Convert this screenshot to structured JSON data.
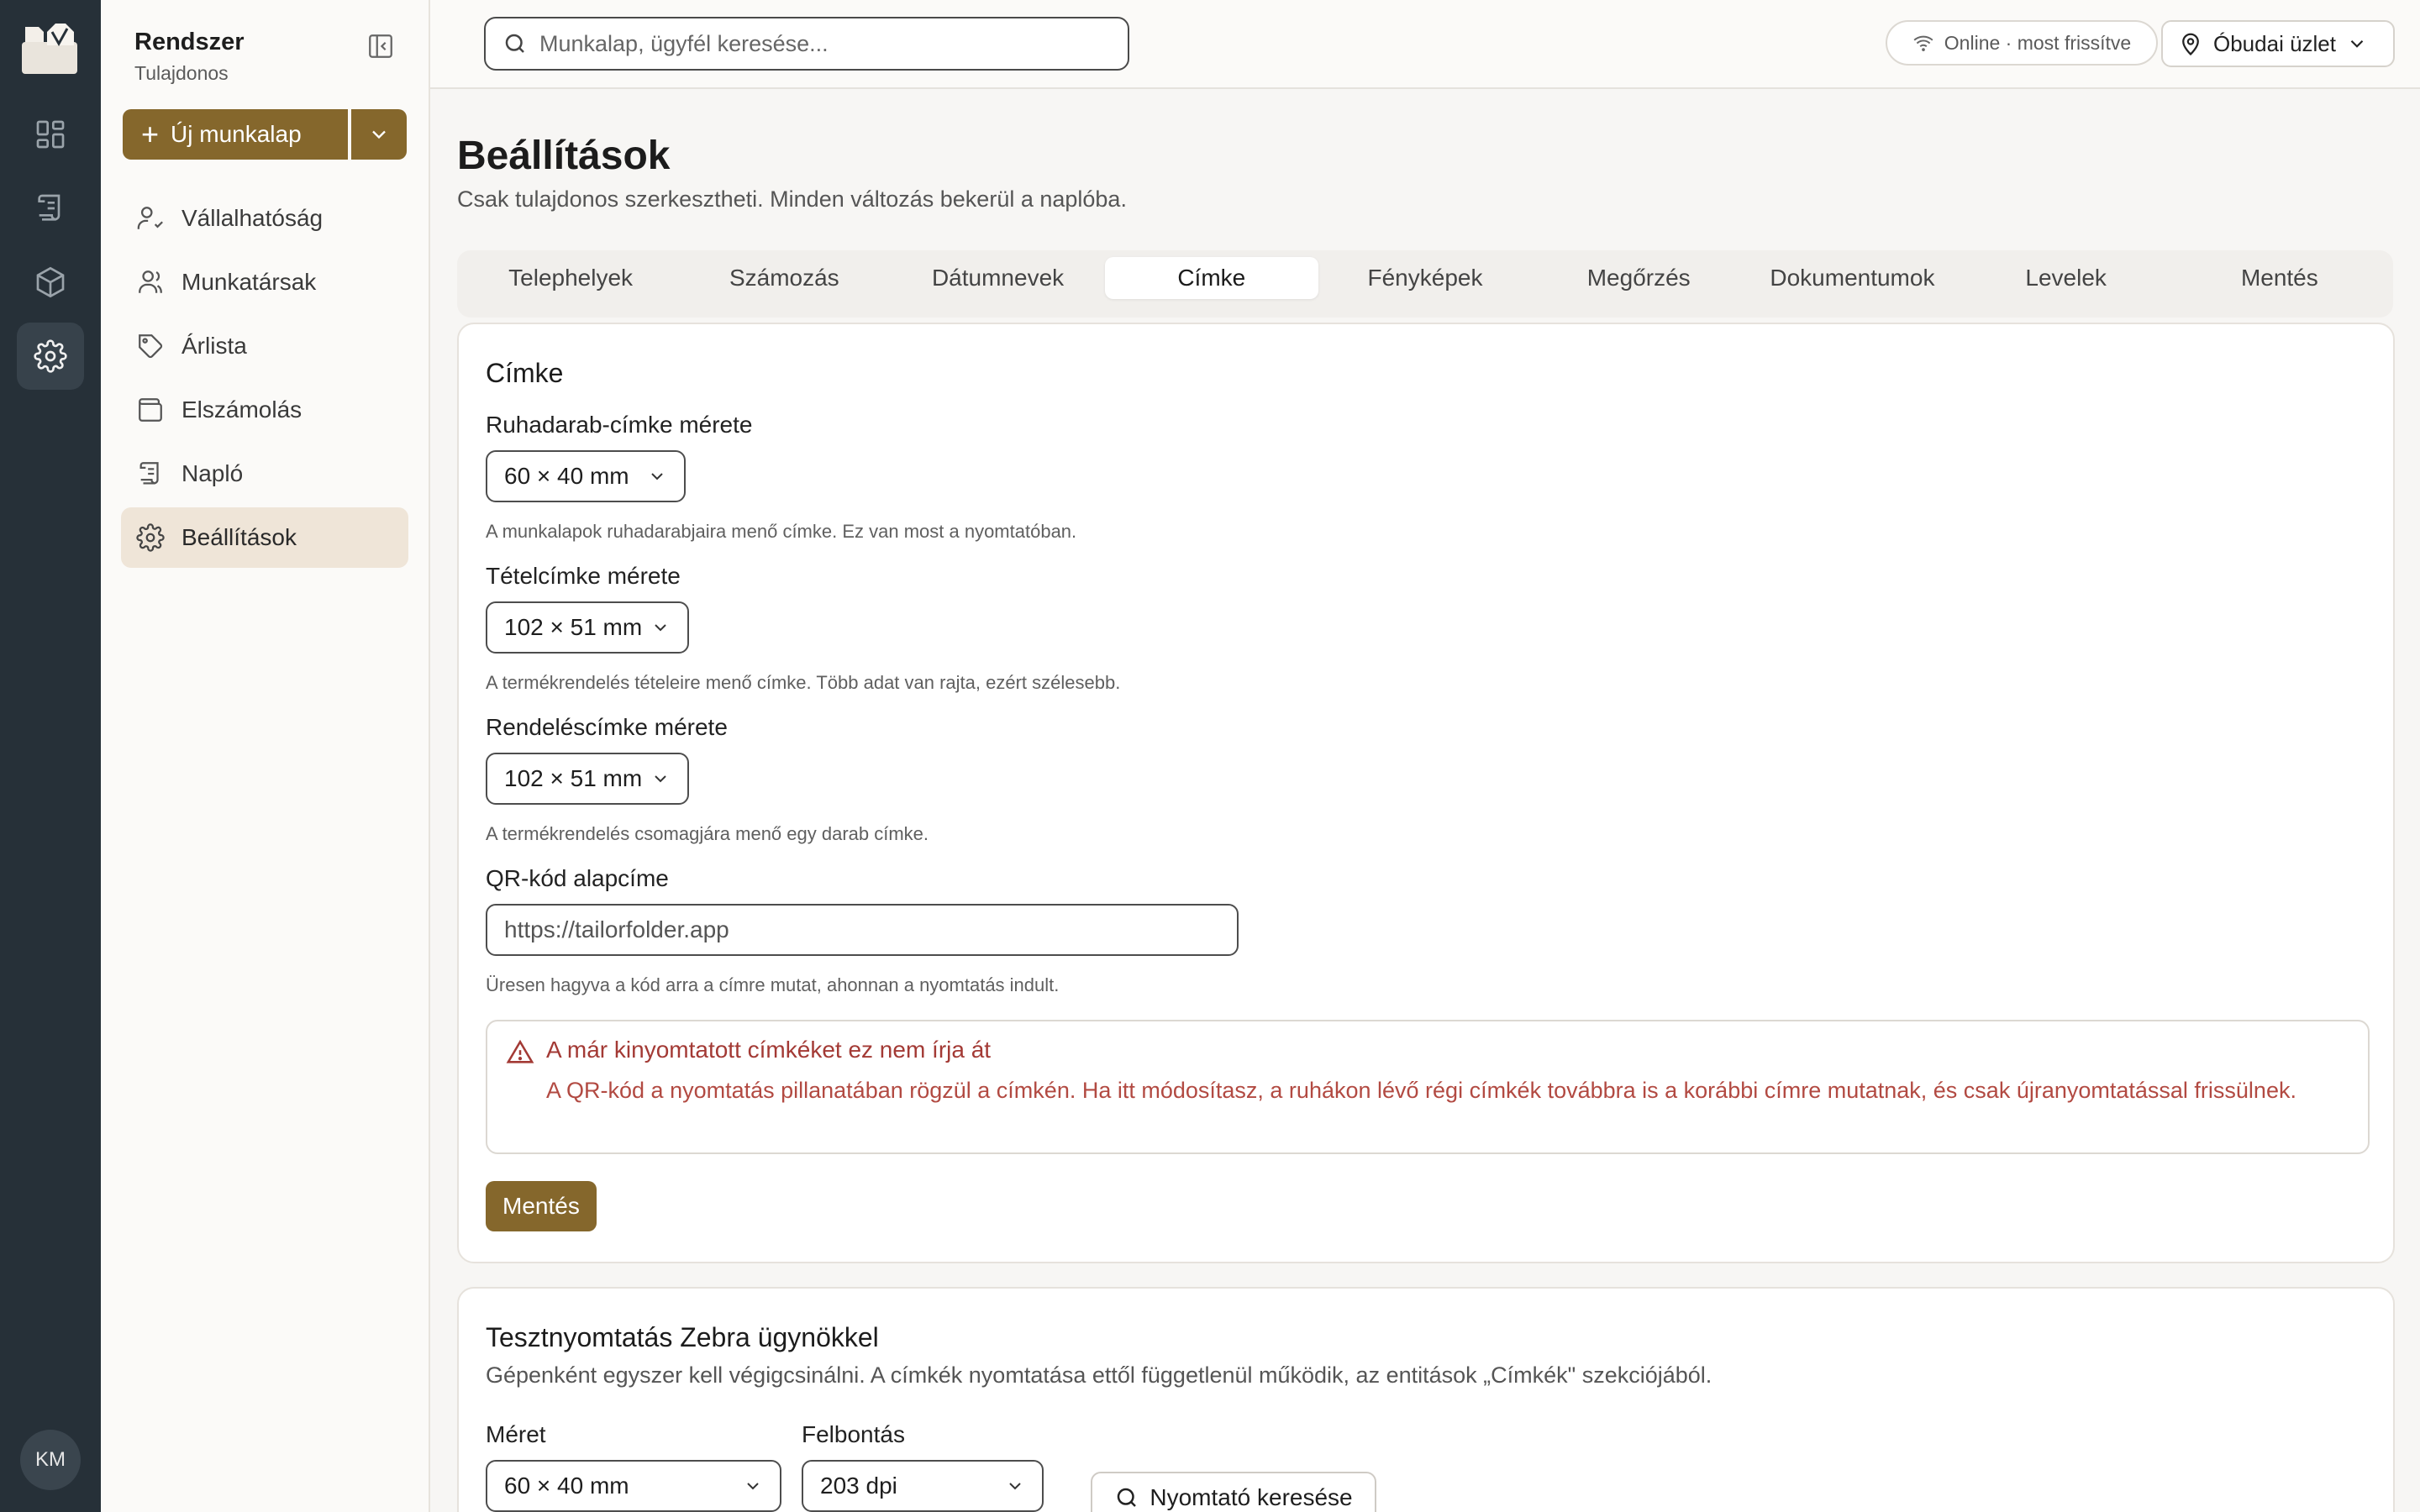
{
  "app": {
    "org_name": "Rendszer",
    "org_role": "Tulajdonos",
    "user_initials": "KM",
    "accent": "#85672c"
  },
  "sidebar": {
    "new_button": "Új munkalap",
    "items": [
      {
        "label": "Vállalhatóság",
        "icon": "user-check-icon"
      },
      {
        "label": "Munkatársak",
        "icon": "users-icon"
      },
      {
        "label": "Árlista",
        "icon": "tag-icon"
      },
      {
        "label": "Elszámolás",
        "icon": "wallet-icon"
      },
      {
        "label": "Napló",
        "icon": "scroll-icon"
      },
      {
        "label": "Beállítások",
        "icon": "gear-icon",
        "active": true
      }
    ]
  },
  "topbar": {
    "search_placeholder": "Munkalap, ügyfél keresése...",
    "status": "Online · most frissítve",
    "store": "Óbudai üzlet"
  },
  "page": {
    "title": "Beállítások",
    "subtitle": "Csak tulajdonos szerkesztheti. Minden változás bekerül a naplóba.",
    "tabs": [
      "Telephelyek",
      "Számozás",
      "Dátumnevek",
      "Címke",
      "Fényképek",
      "Megőrzés",
      "Dokumentumok",
      "Levelek",
      "Mentés"
    ],
    "active_tab": "Címke"
  },
  "label_card": {
    "title": "Címke",
    "garment_label": "Ruhadarab-címke mérete",
    "garment_value": "60 × 40 mm",
    "garment_hint": "A munkalapok ruhadarabjaira menő címke. Ez van most a nyomtatóban.",
    "item_label": "Tételcímke mérete",
    "item_value": "102 × 51 mm",
    "item_hint": "A termékrendelés tételeire menő címke. Több adat van rajta, ezért szélesebb.",
    "order_label": "Rendeléscímke mérete",
    "order_value": "102 × 51 mm",
    "order_hint": "A termékrendelés csomagjára menő egy darab címke.",
    "qr_label": "QR-kód alapcíme",
    "qr_value": "https://tailorfolder.app",
    "qr_hint": "Üresen hagyva a kód arra a címre mutat, ahonnan a nyomtatás indult.",
    "warning_title": "A már kinyomtatott címkéket ez nem írja át",
    "warning_text": "A QR-kód a nyomtatás pillanatában rögzül a címkén. Ha itt módosítasz, a ruhákon lévő régi címkék továbbra is a korábbi címre mutatnak, és csak újranyomtatással frissülnek.",
    "save": "Mentés"
  },
  "test_card": {
    "title": "Tesztnyomtatás Zebra ügynökkel",
    "subtitle": "Gépenként egyszer kell végigcsinálni. A címkék nyomtatása ettől függetlenül működik, az entitások „Címkék\" szekciójából.",
    "size_label": "Méret",
    "size_value": "60 × 40 mm",
    "resolution_label": "Felbontás",
    "resolution_value": "203 dpi",
    "find_printer": "Nyomtató keresése"
  }
}
